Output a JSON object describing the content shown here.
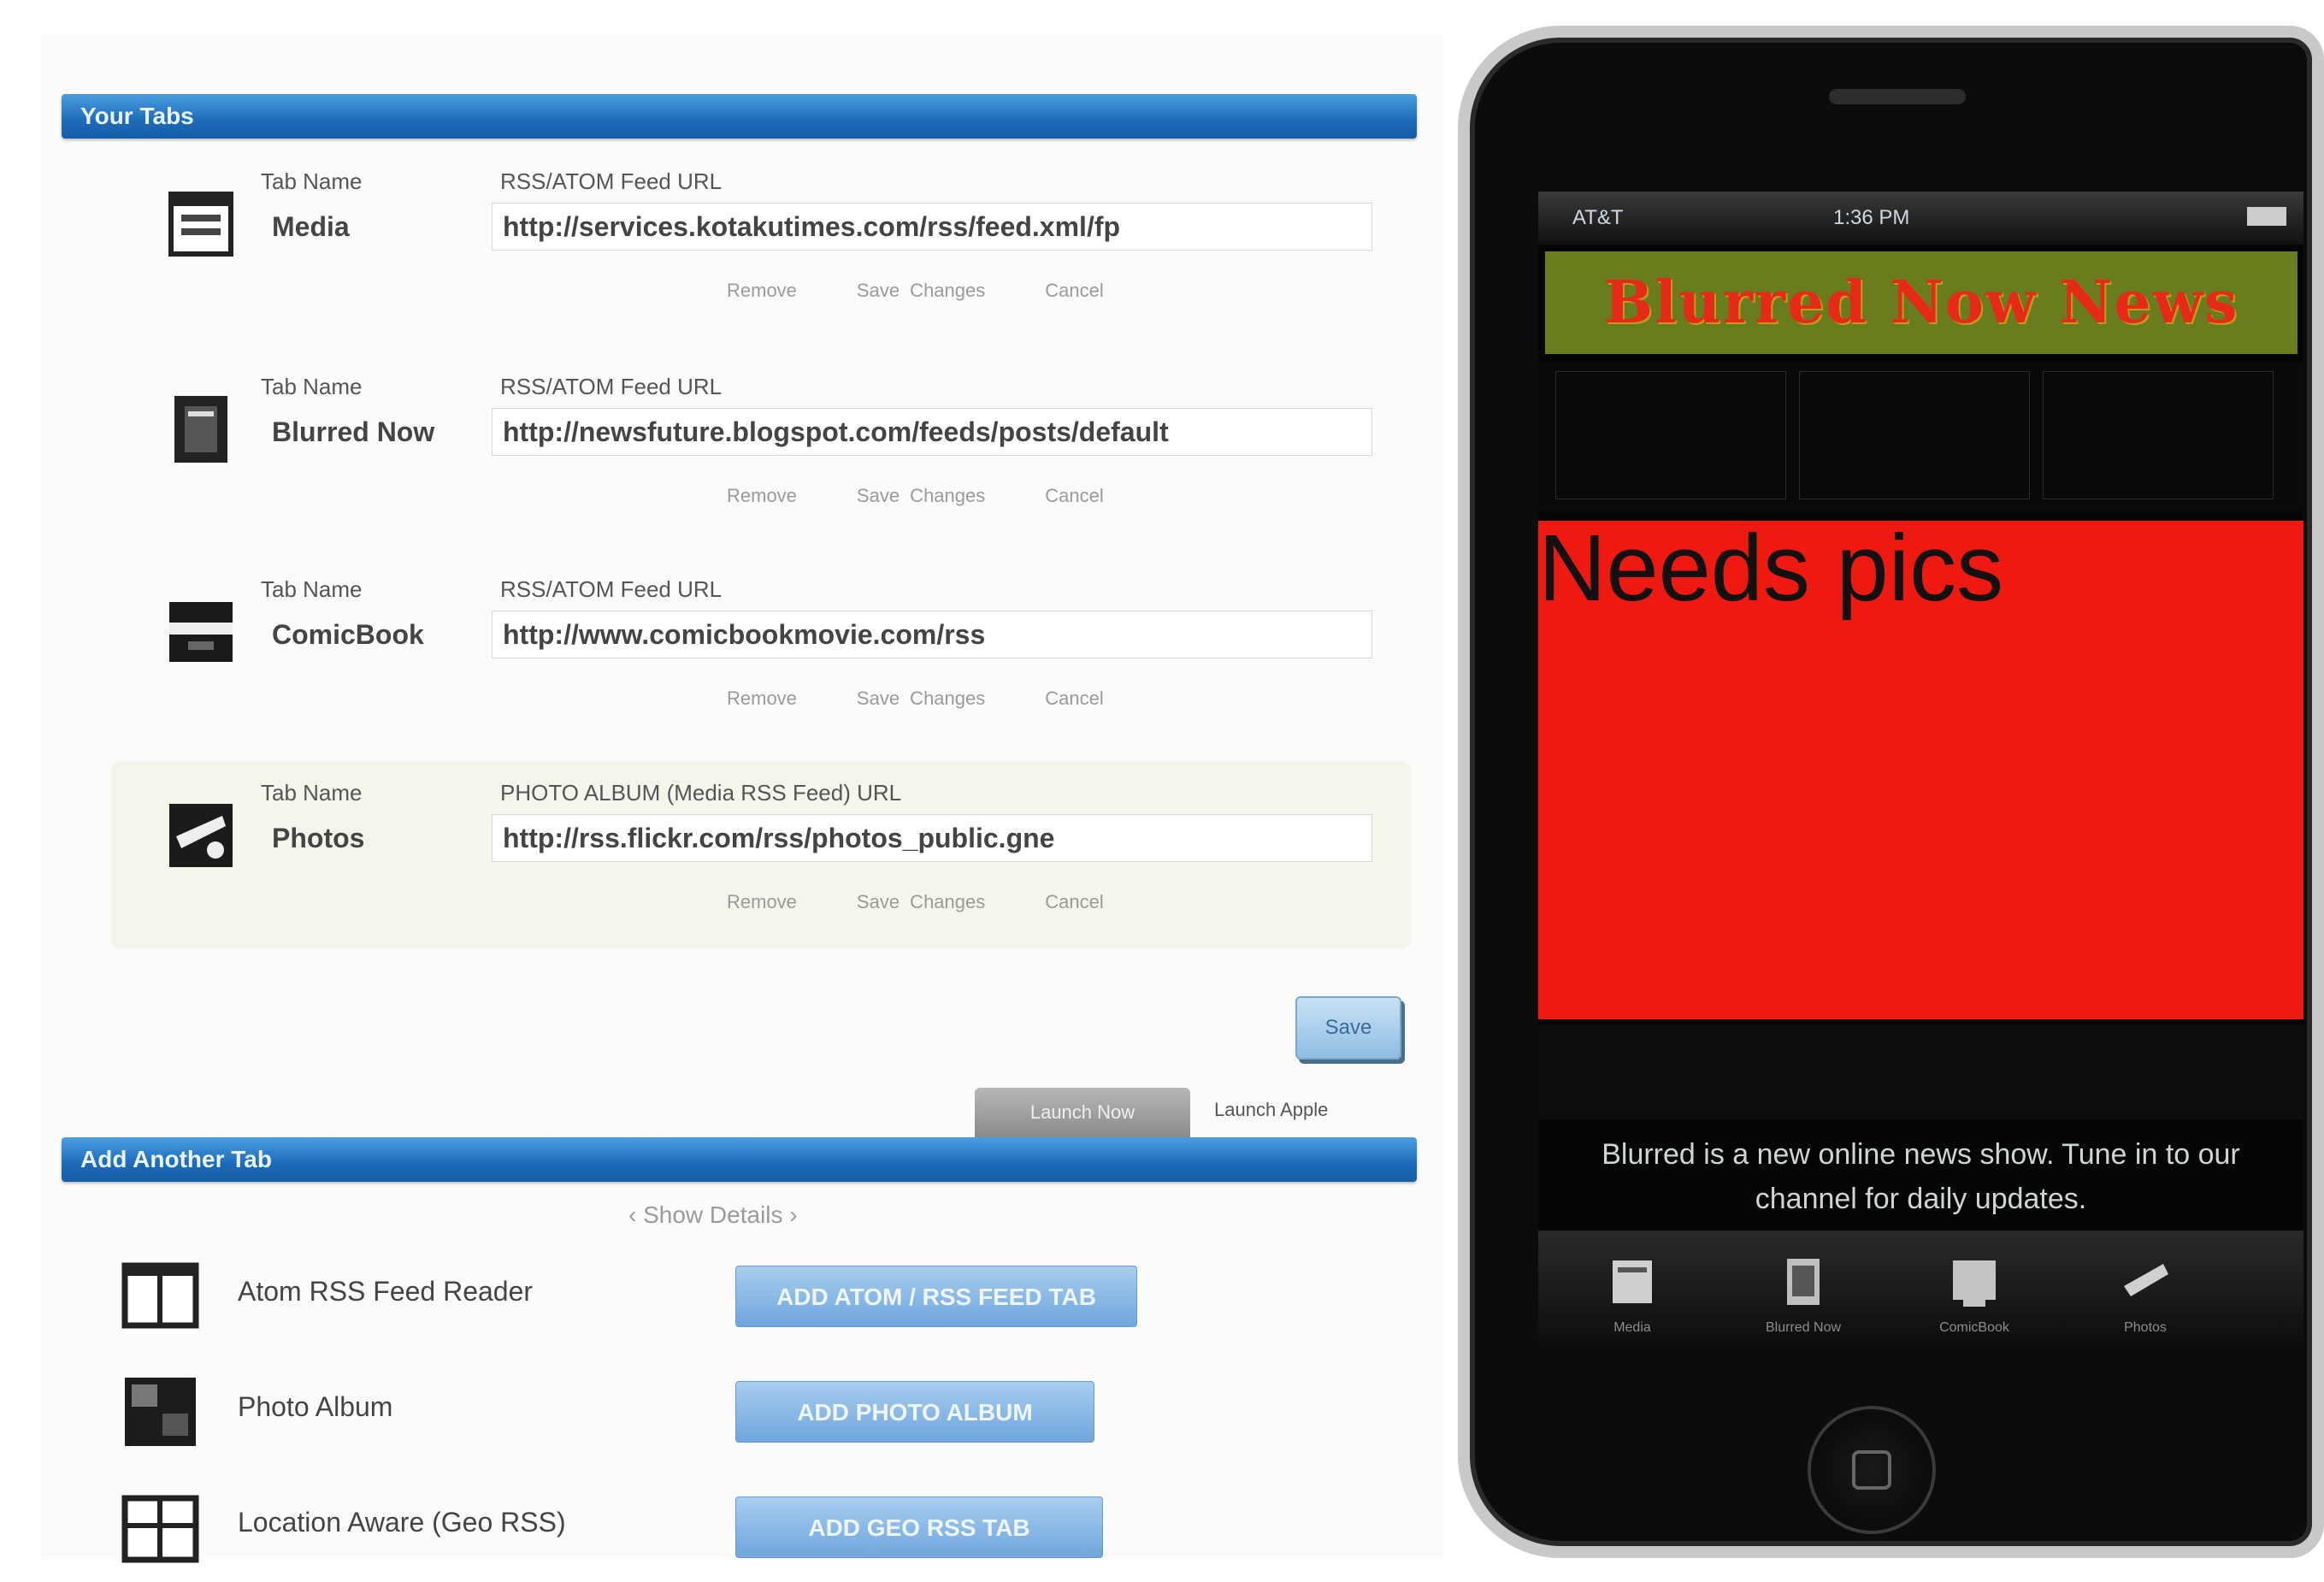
{
  "editor": {
    "tabs_header": "Your Tabs",
    "name_label": "Tab Name",
    "url_label": "RSS/ATOM Feed URL",
    "photo_url_label": "PHOTO ALBUM (Media RSS Feed) URL",
    "row_actions": [
      "Remove",
      "Save Changes",
      "Cancel"
    ],
    "tabs": [
      {
        "name": "Media",
        "url": "http://services.kotakutimes.com/rss/feed.xml/fp",
        "icon": "newspaper-icon"
      },
      {
        "name": "Blurred Now",
        "url": "http://newsfuture.blogspot.com/feeds/posts/default",
        "icon": "document-icon"
      },
      {
        "name": "ComicBook",
        "url": "http://www.comicbookmovie.com/rss",
        "icon": "comic-icon"
      },
      {
        "name": "Photos",
        "url": "http://rss.flickr.com/rss/photos_public.gne",
        "icon": "camera-icon"
      }
    ],
    "save_button": "Save",
    "sub_tab_active": "Launch Now",
    "sub_tab_link": "Launch Apple",
    "add_header": "Add Another Tab",
    "show_details": "‹ Show Details ›",
    "add_options": [
      {
        "label": "Atom RSS Feed Reader",
        "button": "ADD ATOM / RSS FEED TAB",
        "icon": "rss-reader-icon"
      },
      {
        "label": "Photo Album",
        "button": "ADD PHOTO ALBUM",
        "icon": "photo-album-icon"
      },
      {
        "label": "Location Aware (Geo RSS)",
        "button": "ADD GEO RSS TAB",
        "icon": "map-icon"
      }
    ]
  },
  "phone": {
    "carrier": "AT&T",
    "time": "1:36 PM",
    "banner_text": "Blurred Now News",
    "placeholder": "Needs pics",
    "caption": "Blurred is a new online news show. Tune in to our channel for daily updates.",
    "tab_bar": [
      "Media",
      "Blurred Now",
      "ComicBook",
      "Photos"
    ]
  },
  "colors": {
    "section_bar": "#1d6ab8",
    "placeholder_red": "#ee1a12",
    "banner_green": "#6a7d1e",
    "banner_text": "#e52a18"
  }
}
